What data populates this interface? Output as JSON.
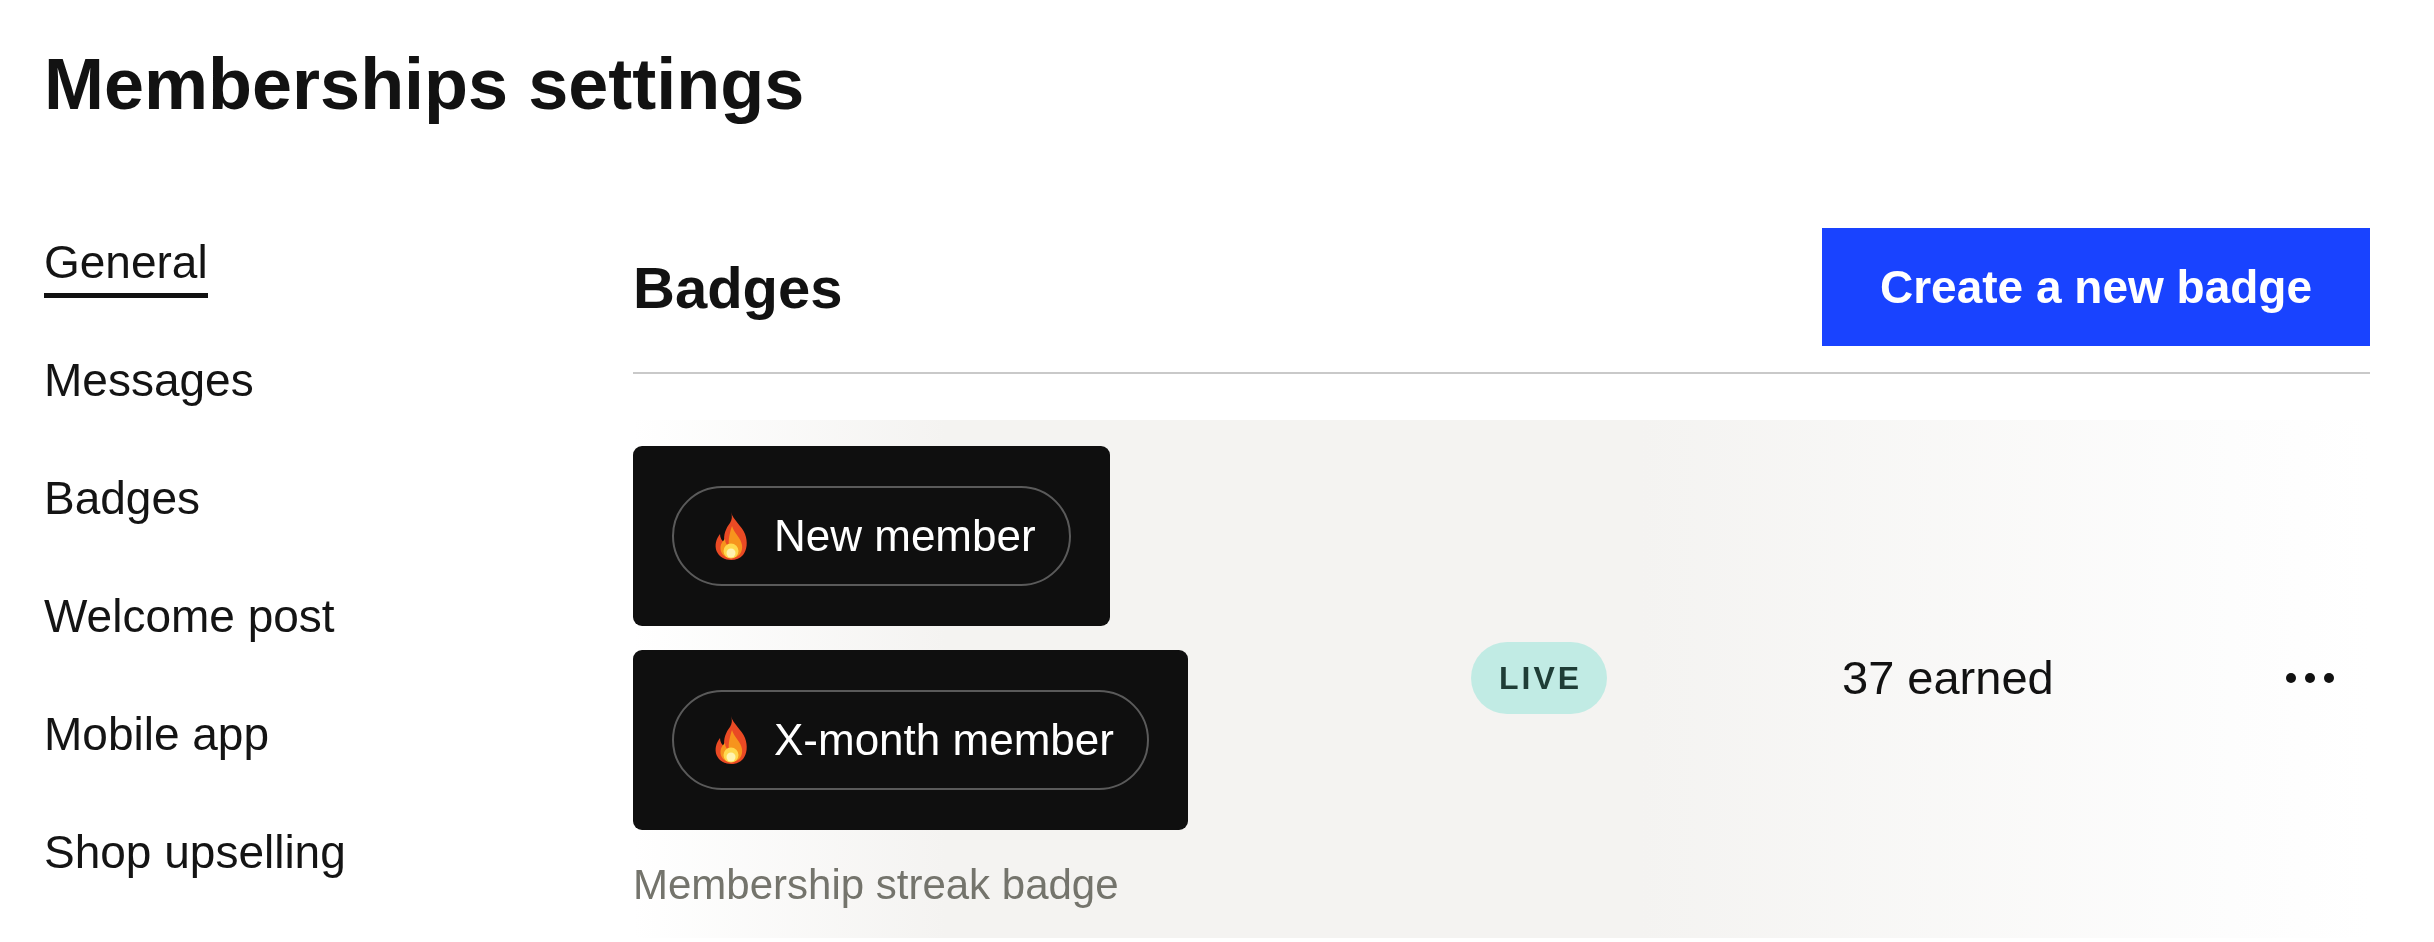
{
  "page": {
    "title": "Memberships settings"
  },
  "sidebar": {
    "items": [
      {
        "label": "General",
        "selected": true
      },
      {
        "label": "Messages",
        "selected": false
      },
      {
        "label": "Badges",
        "selected": false
      },
      {
        "label": "Welcome post",
        "selected": false
      },
      {
        "label": "Mobile app",
        "selected": false
      },
      {
        "label": "Shop upselling",
        "selected": false
      }
    ]
  },
  "section": {
    "title": "Badges",
    "action_button": "Create a new badge"
  },
  "badge_rows": [
    {
      "highlighted": true,
      "badges": [
        {
          "label": "New member"
        },
        {
          "label": "X-month member"
        }
      ],
      "description": "Membership streak badge",
      "status": {
        "label": "LIVE",
        "kind": "live"
      },
      "earned": "37 earned"
    }
  ]
}
